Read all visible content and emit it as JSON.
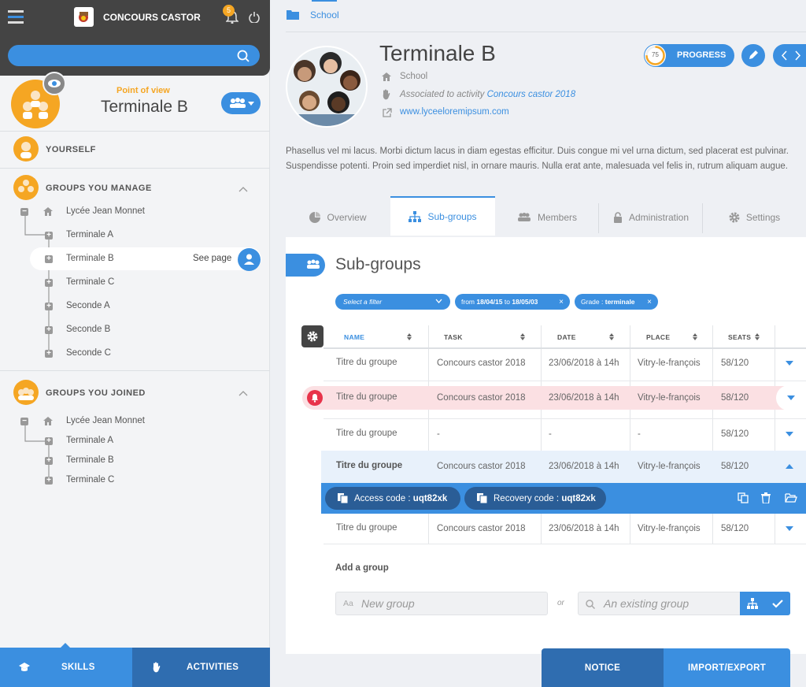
{
  "app": {
    "title": "CONCOURS CASTOR",
    "notif_count": "5"
  },
  "pov": {
    "label": "Point of view",
    "group": "Terminale B"
  },
  "sidebar": {
    "yourself": "YOURSELF",
    "manage": {
      "title": "GROUPS YOU MANAGE",
      "root": "Lycée Jean Monnet",
      "items": [
        "Terminale A",
        "Terminale B",
        "Terminale C",
        "Seconde A",
        "Seconde B",
        "Seconde C"
      ],
      "see_page": "See page"
    },
    "joined": {
      "title": "GROUPS YOU JOINED",
      "root": "Lycée Jean Monnet",
      "items": [
        "Terminale A",
        "Terminale B",
        "Terminale C"
      ]
    },
    "tabs": {
      "skills": "SKILLS",
      "activities": "ACTIVITIES"
    }
  },
  "breadcrumb": "School",
  "header": {
    "title": "Terminale B",
    "type": "School",
    "associated_prefix": "Associated to activity",
    "associated_link": "Concours castor 2018",
    "website": "www.lyceeloremipsum.com",
    "progress_value": "75",
    "progress_label": "PROGRESS"
  },
  "description": "Phasellus vel mi lacus. Morbi dictum lacus in diam egestas efficitur. Duis congue mi vel urna dictum, sed placerat est pulvinar. Suspendisse potenti. Proin sed imperdiet nisl, in ornare mauris. Nulla erat ante, malesuada vel felis in, rutrum aliquam augue.",
  "tabs": [
    "Overview",
    "Sub-groups",
    "Members",
    "Administration",
    "Settings"
  ],
  "subgroups": {
    "title": "Sub-groups",
    "filter_placeholder": "Select a filter",
    "chip_date": {
      "prefix": "from",
      "from": "18/04/15",
      "mid": "to",
      "to": "18/05/03"
    },
    "chip_grade": {
      "prefix": "Grade :",
      "value": "terminale"
    },
    "columns": [
      "NAME",
      "TASK",
      "DATE",
      "PLACE",
      "SEATS"
    ],
    "rows": [
      {
        "name": "Titre du groupe",
        "task": "Concours castor 2018",
        "date": "23/06/2018 à 14h",
        "place": "Vitry-le-françois",
        "seats": "58/120"
      },
      {
        "name": "Titre du groupe",
        "task": "Concours castor 2018",
        "date": "23/06/2018 à 14h",
        "place": "Vitry-le-françois",
        "seats": "58/120"
      },
      {
        "name": "Titre du groupe",
        "task": "-",
        "date": "-",
        "place": "-",
        "seats": "58/120"
      },
      {
        "name": "Titre du groupe",
        "task": "Concours castor 2018",
        "date": "23/06/2018 à 14h",
        "place": "Vitry-le-françois",
        "seats": "58/120"
      },
      {
        "name": "Titre du groupe",
        "task": "Concours castor 2018",
        "date": "23/06/2018 à 14h",
        "place": "Vitry-le-françois",
        "seats": "58/120"
      }
    ],
    "access_label": "Access code :",
    "access_code": "uqt82xk",
    "recovery_label": "Recovery code :",
    "recovery_code": "uqt82xk",
    "add_group": "Add a group",
    "new_group_prefix": "Aa",
    "new_group_placeholder": "New group",
    "or": "or",
    "existing_placeholder": "An existing group"
  },
  "footer": {
    "notice": "NOTICE",
    "import_export": "IMPORT/EXPORT"
  },
  "colors": {
    "accent": "#3b8fe0",
    "dark": "#444444",
    "orange": "#f5a623",
    "alert": "#e8334a"
  }
}
